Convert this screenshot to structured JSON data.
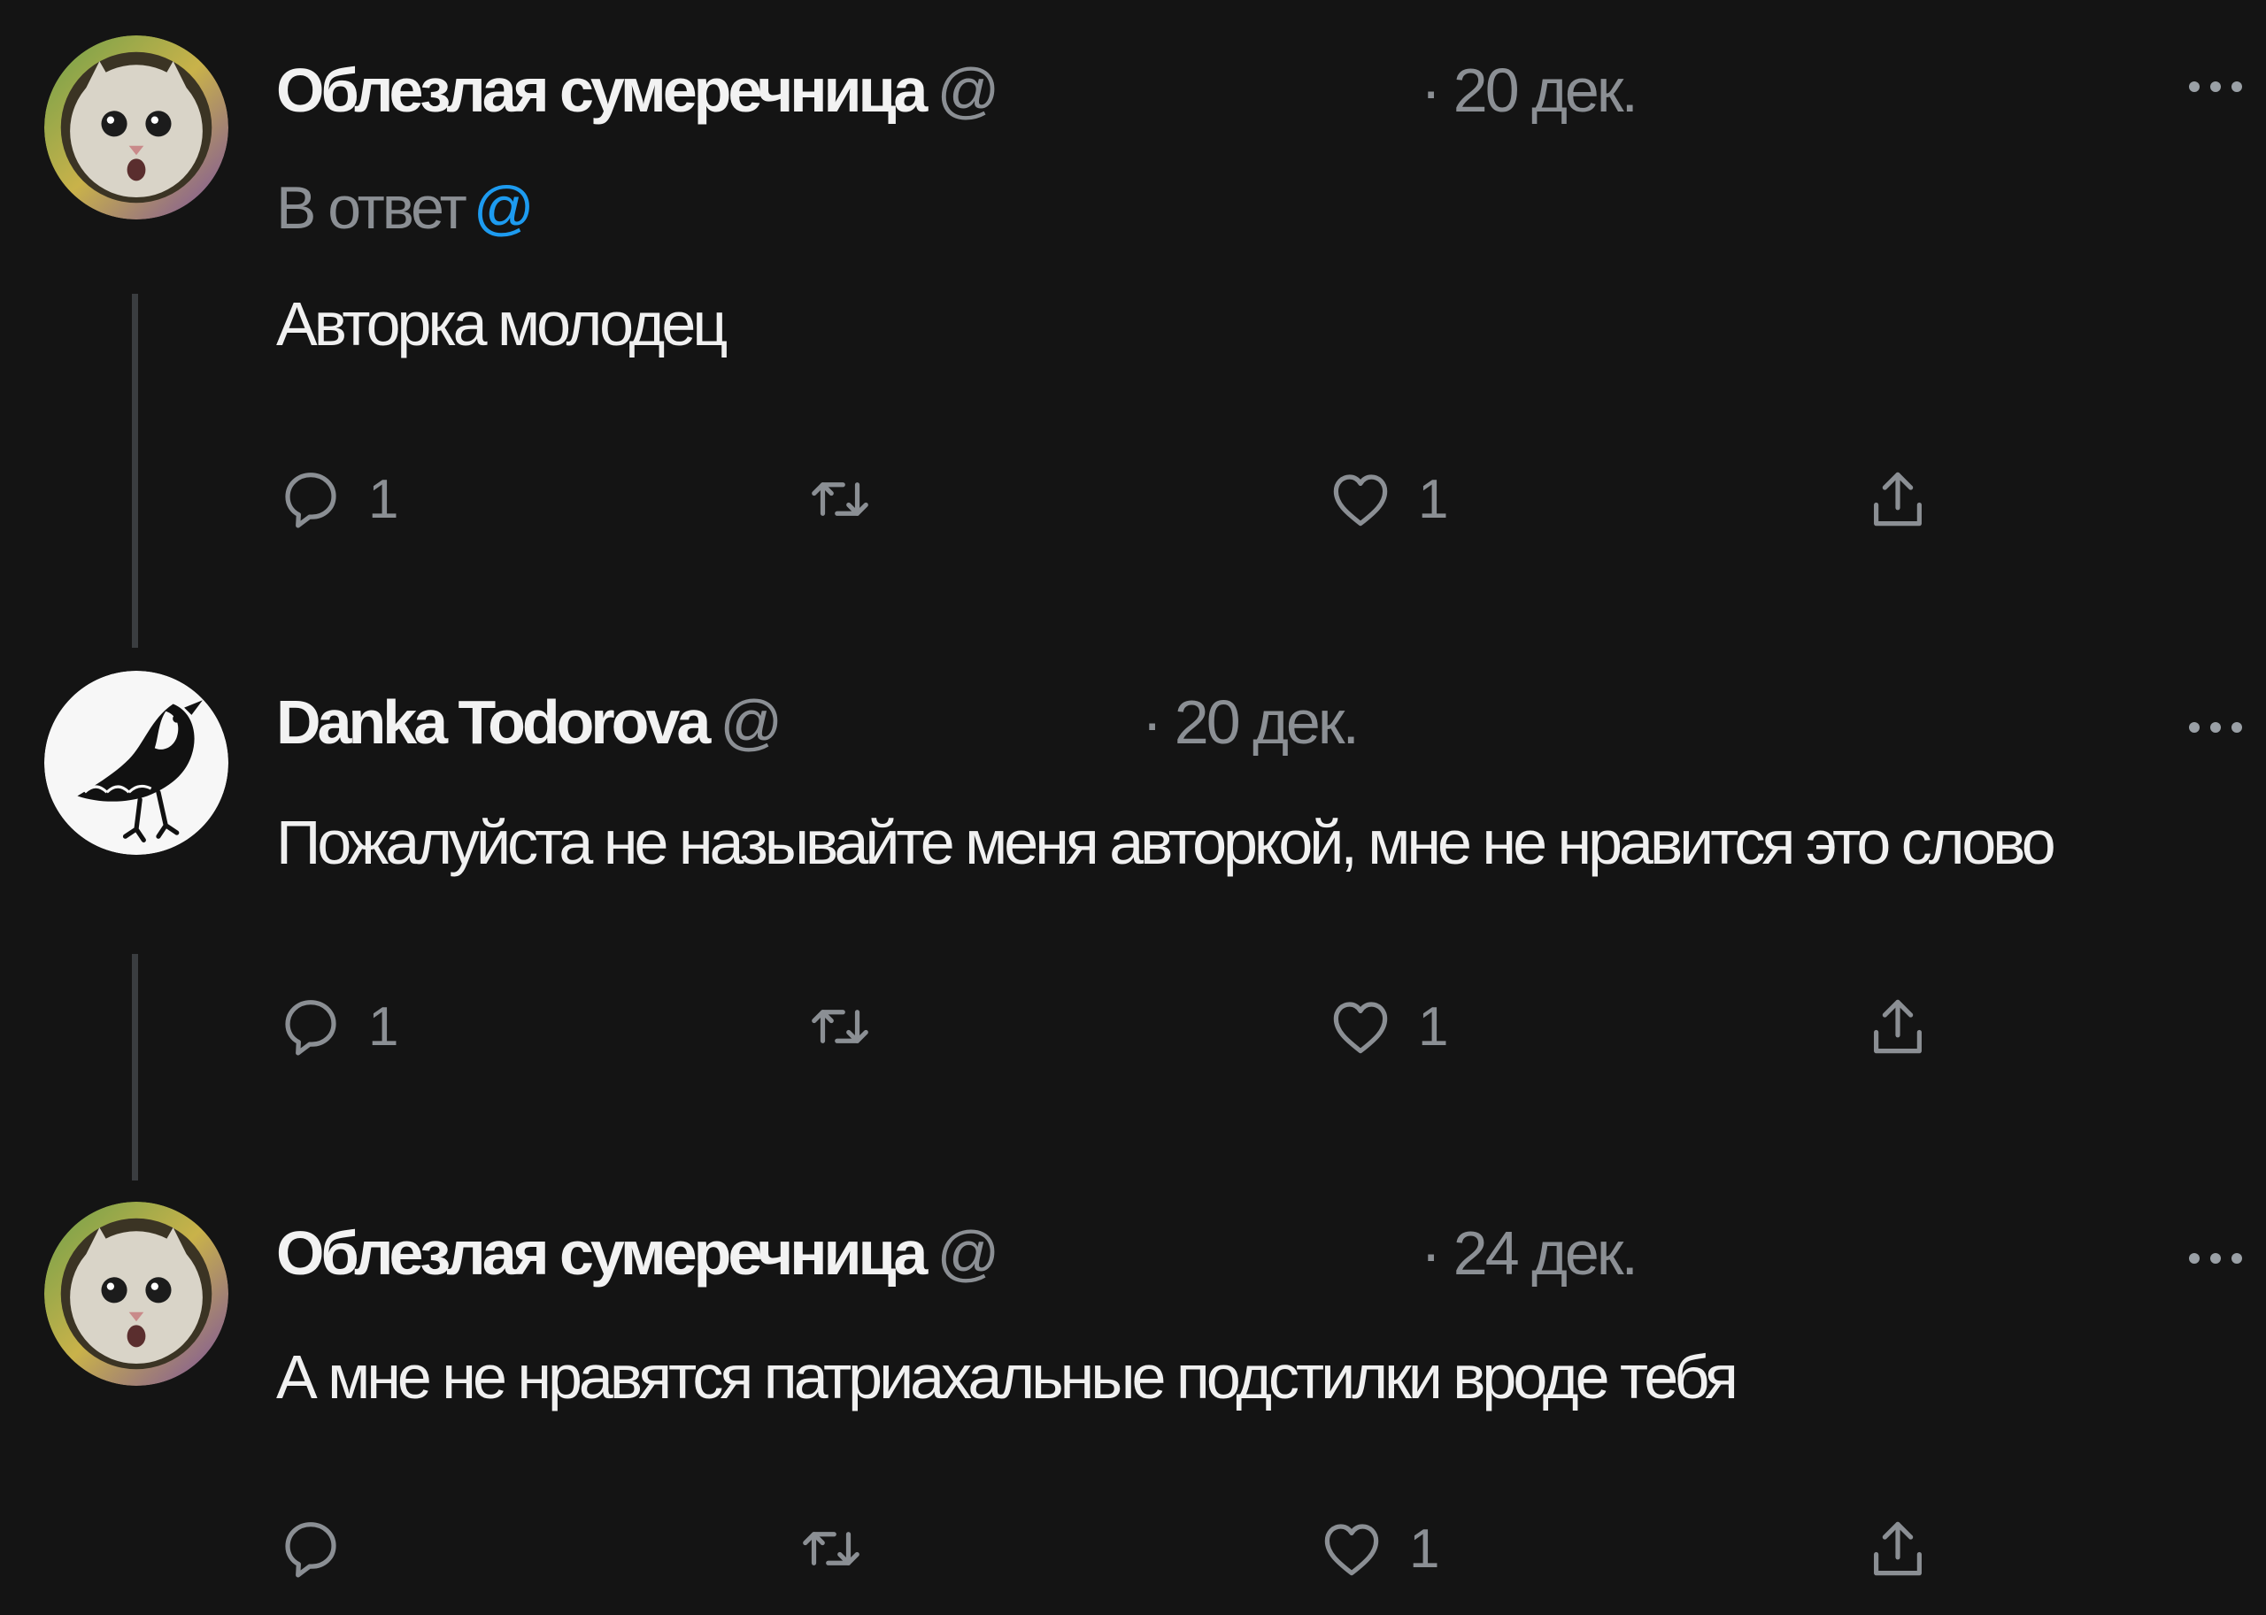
{
  "tweets": [
    {
      "author": "Облезлая сумеречница",
      "handle": "@",
      "date": "· 20 дек.",
      "reply_prefix": "В ответ",
      "reply_mention": "@",
      "text": "Авторка молодец",
      "reply_count": "1",
      "retweet_count": "",
      "like_count": "1"
    },
    {
      "author": "Danka Todorova",
      "handle": "@",
      "date": "· 20 дек.",
      "text": "Пожалуйста не называйте меня авторкой, мне не нравится это слово",
      "reply_count": "1",
      "retweet_count": "",
      "like_count": "1"
    },
    {
      "author": "Облезлая сумеречница",
      "handle": "@",
      "date": "· 24 дек.",
      "text": "А мне не нравятся патриахальные подстилки вроде тебя",
      "reply_count": "",
      "retweet_count": "",
      "like_count": "1"
    }
  ],
  "icons": {
    "reply": "reply-icon",
    "retweet": "retweet-icon",
    "like": "heart-icon",
    "share": "share-icon",
    "more": "more-icon"
  },
  "colors": {
    "background": "#141414",
    "muted": "#8b8f94",
    "mention": "#1d9bf0",
    "thread_line": "#3a3d40"
  }
}
